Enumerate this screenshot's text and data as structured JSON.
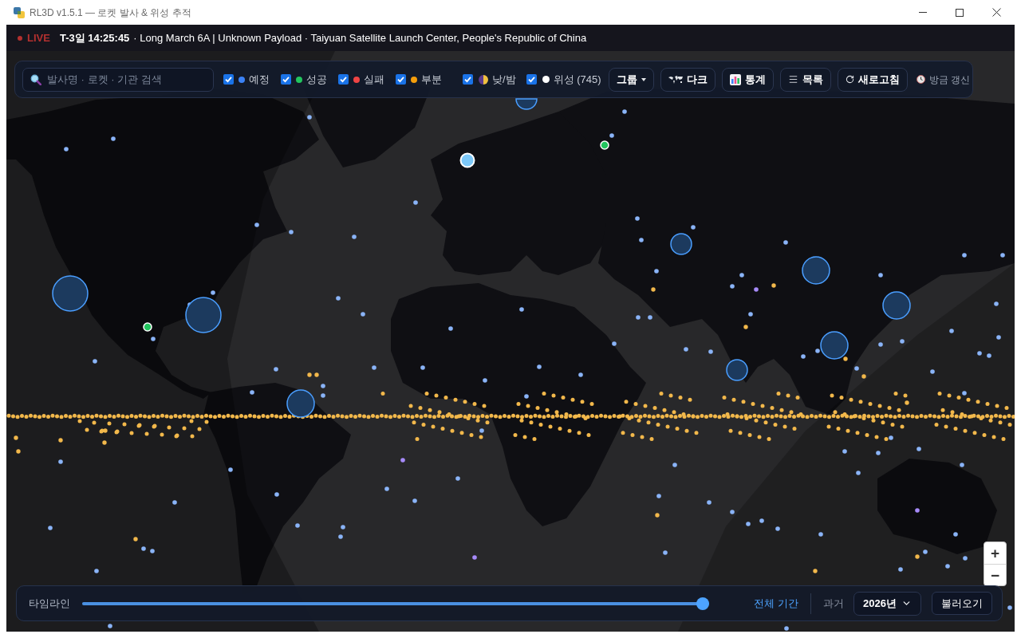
{
  "window": {
    "title": "RL3D v1.5.1 — 로켓 발사 & 위성 추적"
  },
  "live_banner": {
    "live_label": "LIVE",
    "countdown": "T-3일 14:25:45",
    "details": "· Long March 6A | Unknown Payload · Taiyuan Satellite Launch Center, People's Republic of China"
  },
  "toolbar": {
    "search": {
      "placeholder": "발사명 · 로켓 · 기관 검색"
    },
    "status_filters": [
      {
        "label": "예정",
        "checked": true,
        "color": "#3b82f6"
      },
      {
        "label": "성공",
        "checked": true,
        "color": "#22c55e"
      },
      {
        "label": "실패",
        "checked": true,
        "color": "#ef4444"
      },
      {
        "label": "부분",
        "checked": true,
        "color": "#f59e0b"
      }
    ],
    "layer_toggles": [
      {
        "kind": "daynight",
        "label": "낮/밤",
        "checked": true
      },
      {
        "kind": "satellites",
        "label": "위성 (745)",
        "checked": true
      }
    ],
    "buttons": [
      {
        "kind": "dropdown",
        "label": "그룹"
      },
      {
        "kind": "theme",
        "label": "다크"
      },
      {
        "kind": "stats",
        "label": "통계"
      },
      {
        "kind": "list",
        "label": "목록"
      },
      {
        "kind": "refresh",
        "label": "새로고침"
      }
    ],
    "update_status": "방금 갱신"
  },
  "zoom_controls": [
    {
      "label": "+"
    },
    {
      "label": "−"
    }
  ],
  "timeline": {
    "label": "타임라인",
    "level": 1,
    "range_link": "전체 기간",
    "past_label": "과거",
    "year_select": "2026년",
    "load_button": "불러오기"
  }
}
